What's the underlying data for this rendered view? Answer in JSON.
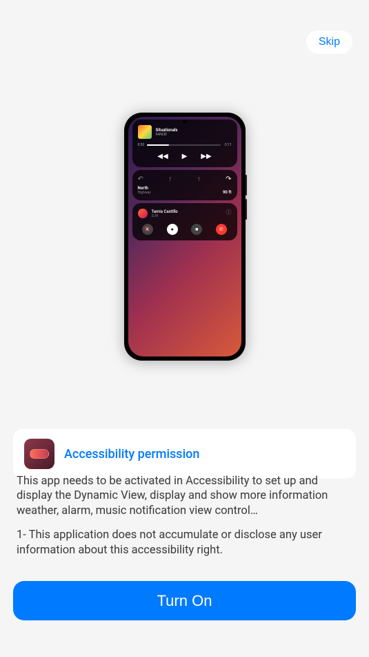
{
  "skip_label": "Skip",
  "phone": {
    "music": {
      "title": "Situationals",
      "artist": "FANCIE",
      "time_current": "0:50",
      "time_remaining": "-3:11"
    },
    "nav": {
      "location": "North",
      "sublocation": "Highway",
      "distance": "90 ft"
    },
    "call": {
      "name": "Tamia Castillo",
      "time": "2:29"
    }
  },
  "permission": {
    "title": "Accessibility permission",
    "paragraph1": "This app needs to be activated in Accessibility to set up and display the Dynamic View, display and show more information weather, alarm, music notification view control…",
    "paragraph2": "1- This application does not accumulate or disclose any user information about this accessibility right."
  },
  "turn_on_label": "Turn On"
}
